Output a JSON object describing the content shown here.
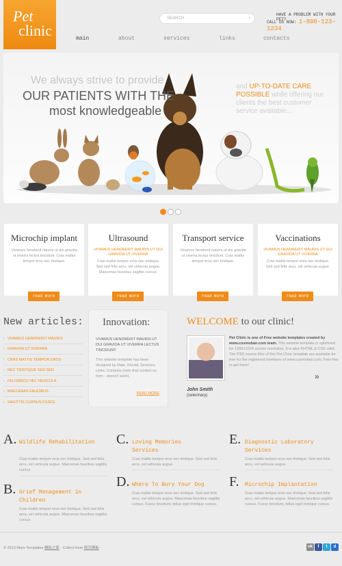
{
  "logo": {
    "line1": "Pet",
    "line2": "clinic"
  },
  "search": {
    "placeholder": "SEARCH"
  },
  "contact": {
    "line1": "HAVE A PROBLEM WITH YOUR PET?",
    "call_label": "CALL US NOW:",
    "phone": "1-800-123-1234"
  },
  "nav": [
    "main",
    "about",
    "services",
    "links",
    "contacts"
  ],
  "banner": {
    "line1": "We always strive to provide",
    "line2": "OUR PATIENTS WITH THE",
    "line3": "most knowledgeable",
    "right_pre": "and",
    "right_hl": "UP-TO-DATE CARE POSSIBLE",
    "right_post": "while offering our clients the best customer service available..."
  },
  "slider_dots": 3,
  "services": [
    {
      "title": "Microchip implant",
      "sub": "",
      "text": "Vivamus hendrerit mauris ut dui gravida ut viverra lectus tincidunt. Cras mattis tempor eros nec tristique."
    },
    {
      "title": "Ultrasound",
      "sub": "VIVAMUS HENDRERIT MAURIS UT DUI GRAVIDA UT VIVERRA",
      "text": "Cras mattis tempor eros nec tristique. Sed sed felis arcu, vel vehicula augue. Maecenas faucibus sagittis cursus."
    },
    {
      "title": "Transport service",
      "sub": "",
      "text": "Vivamus hendrerit mauris ut dui gravida ut viverra lectus tincidunt. Cras mattis tempor eros nec tristique."
    },
    {
      "title": "Vaccinations",
      "sub": "VIVAMUS HENDRERIT MAURIS UT DUI GRAVIDA UT VIVERRA",
      "text": "Cras mattis tempor eros nec tristique. Sed sed felis arcu, vel vehicula augue."
    }
  ],
  "read_more": "read more",
  "articles": {
    "heading": "New articles:",
    "items": [
      "VIVAMUS HENDRERIT MAURIS",
      "GRAVIDA UT VIVERRA",
      "CRAS MATTIS TEMPOR EROS",
      "NEC TRISTIQUE SED SED",
      "FELISARCU VEL VEHICULA",
      "MAECENAS FAUCIBUS",
      "SAGITTIS CURSUS FUSCE"
    ]
  },
  "innovation": {
    "heading": "Innovation:",
    "sub": "VIVAMUS HENDRERIT MAURIS UT DUI GRAVIDA UT VIVERRA LECTUS TINCIDUNT.",
    "text": "This website template has been designed by Main, Khrold, Services, Links, Contacts (note that contact us form - doesn't work).",
    "more": "READ MORE"
  },
  "welcome": {
    "heading_hl": "WELCOME",
    "heading_rest": " to our clinic!",
    "bold": "Pet Clinic is one of Free website templates created by www.cssmoban.com team.",
    "text": "This website template is optimized for 1280X1024 screen resolution. It is also XHTML & CSS valid. The PSD source files of this Pet Clinic template are available for free for the registered members of www.cssmoban.com. Feel free to get them!",
    "name": "John Smith",
    "role": "(veterinary)"
  },
  "features": [
    {
      "letter": "A.",
      "title": "Wildlife Rehabilitation",
      "text": "Cras mattis tempor eros nec tristique. Sed sed felis arcu, vel vehicula augue. Maecenas faucibus sagittis cursus."
    },
    {
      "letter": "B.",
      "title": "Grief Management in Children",
      "text": "Cras mattis tempor eros nec tristique. Sed sed felis arcu, vel vehicula augue. Maecenas faucibus sagittis cursus."
    },
    {
      "letter": "C.",
      "title": "Loving Memories Services",
      "text": "Cras mattis tempor eros nec tristique. Sed sed felis arcu, vel vehicula augue."
    },
    {
      "letter": "D.",
      "title": "Where To Bury Your Dog",
      "text": "Cras mattis tempor eros nec tristique. Sed sed felis arcu, vel vehicula augue. Maecenas faucibus sagittis cursus. Fusce tincidunt, tellus eget tristique cursus."
    },
    {
      "letter": "E.",
      "title": "Diagnostic Laboratory Services",
      "text": "Cras mattis tempor eros nec tristique. Sed sed felis arcu, vel vehicula augue."
    },
    {
      "letter": "F.",
      "title": "Microchip Implantation",
      "text": "Cras mattis tempor eros nec tristique. Sed sed felis arcu, vel vehicula augue. Maecenas faucibus sagittis cursus. Fusce tincidunt, tellus eget tristique cursus."
    }
  ],
  "footer": {
    "copy": "© 2013 More Templates",
    "link1": "模板之家",
    "mid": " - Collect from ",
    "link2": "网页模板"
  },
  "social": [
    "ok",
    "facebook",
    "twitter",
    "delicious"
  ],
  "colors": {
    "accent": "#ef8b18",
    "background": "#ececec"
  }
}
